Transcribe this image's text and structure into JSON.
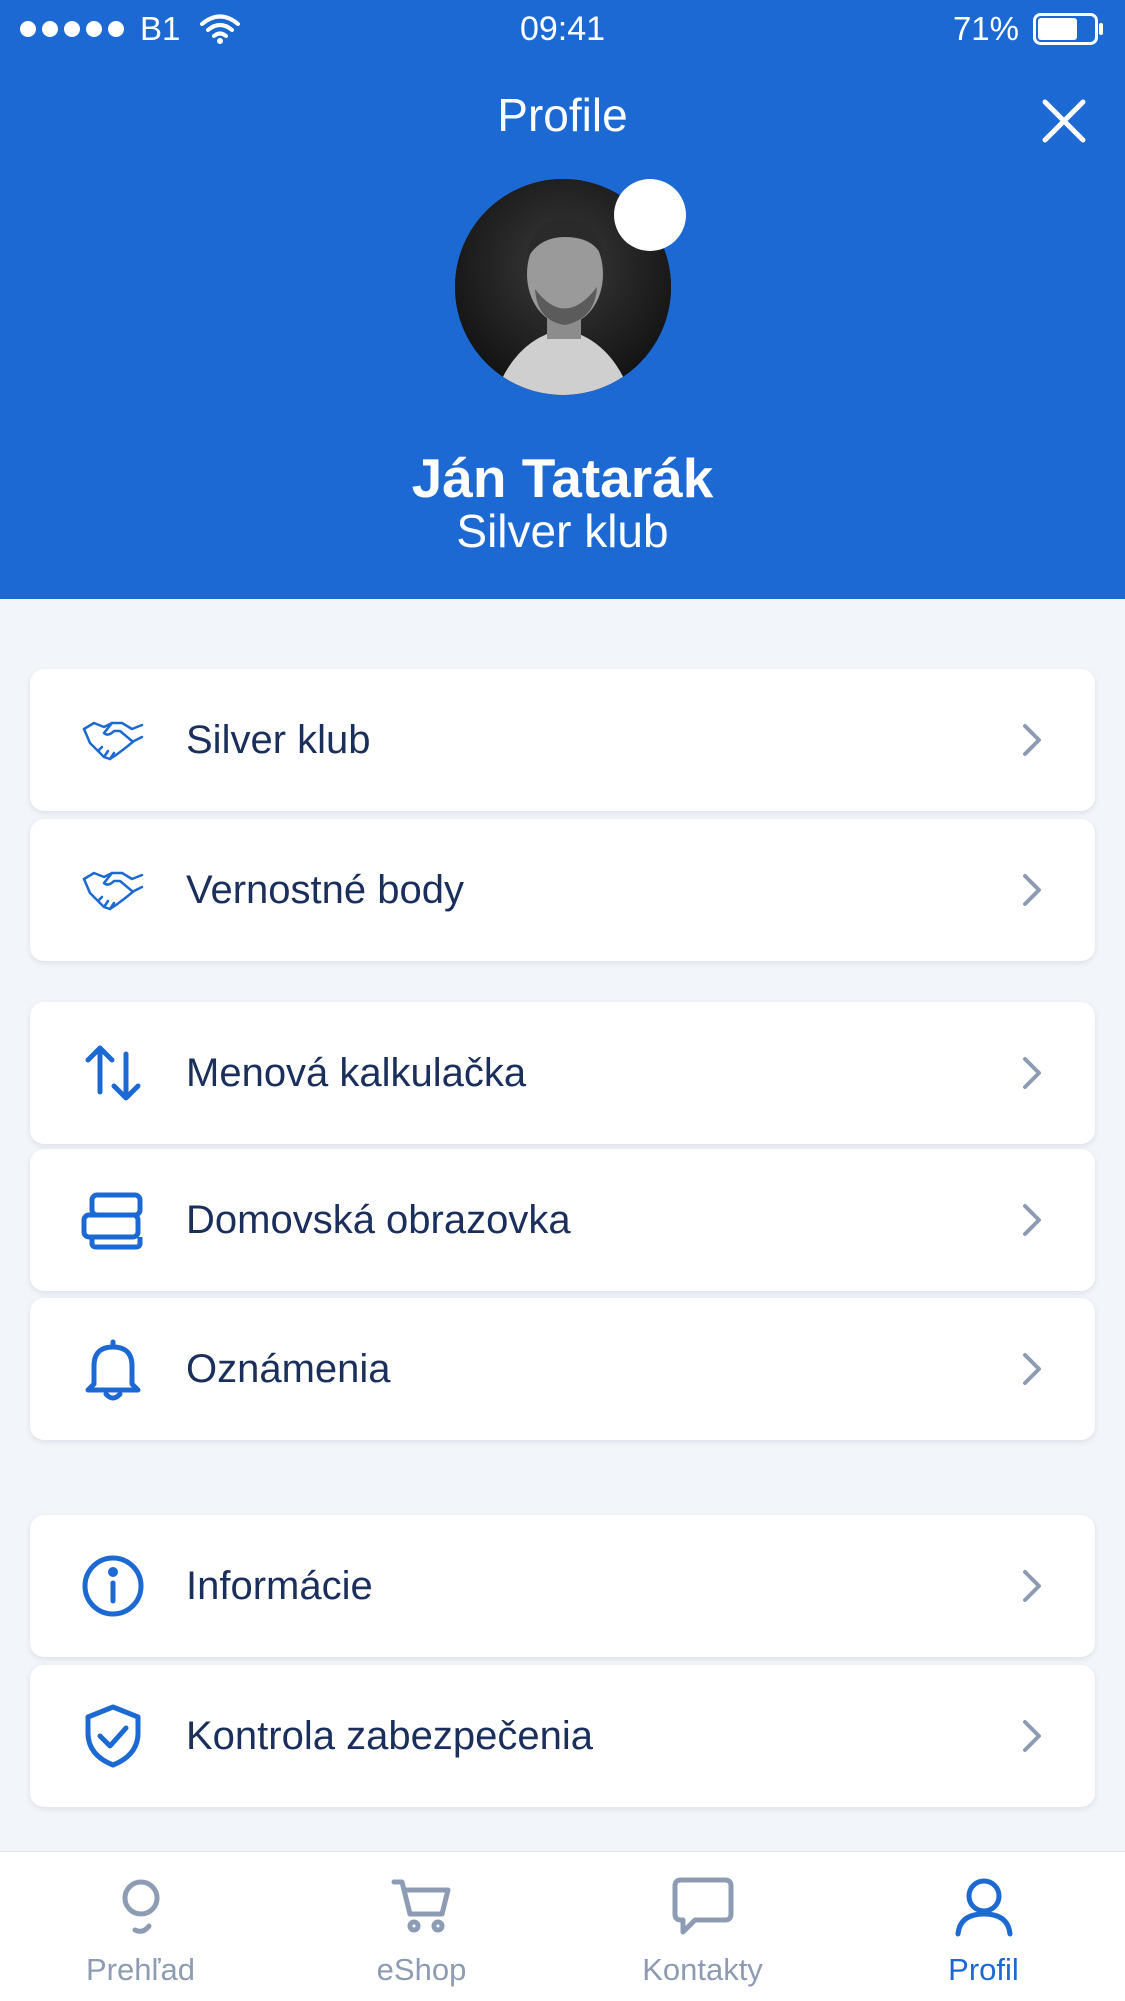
{
  "status_bar": {
    "carrier": "B1",
    "time": "09:41",
    "battery": "71%",
    "battery_level": 0.71
  },
  "header": {
    "title": "Profile",
    "close_icon": "close-icon"
  },
  "profile": {
    "name": "Ján Tatarák",
    "club": "Silver klub"
  },
  "menu": {
    "items": [
      {
        "label": "Silver klub",
        "icon": "handshake-icon"
      },
      {
        "label": "Vernostné body",
        "icon": "handshake-icon"
      },
      {
        "label": "Menová kalkulačka",
        "icon": "exchange-arrows-icon"
      },
      {
        "label": "Domovská obrazovka",
        "icon": "home-screen-icon"
      },
      {
        "label": "Oznámenia",
        "icon": "bell-icon"
      },
      {
        "label": "Informácie",
        "icon": "info-icon"
      },
      {
        "label": "Kontrola zabezpečenia",
        "icon": "shield-check-icon"
      }
    ]
  },
  "tabbar": {
    "tabs": [
      {
        "label": "Prehľad",
        "icon": "overview-icon",
        "active": false
      },
      {
        "label": "eShop",
        "icon": "cart-icon",
        "active": false
      },
      {
        "label": "Kontakty",
        "icon": "chat-icon",
        "active": false
      },
      {
        "label": "Profil",
        "icon": "user-icon",
        "active": true
      }
    ]
  },
  "colors": {
    "brand": "#1c69d4",
    "background": "#f2f5f9",
    "text": "#1b2f5c",
    "inactive": "#8e9cb3"
  }
}
